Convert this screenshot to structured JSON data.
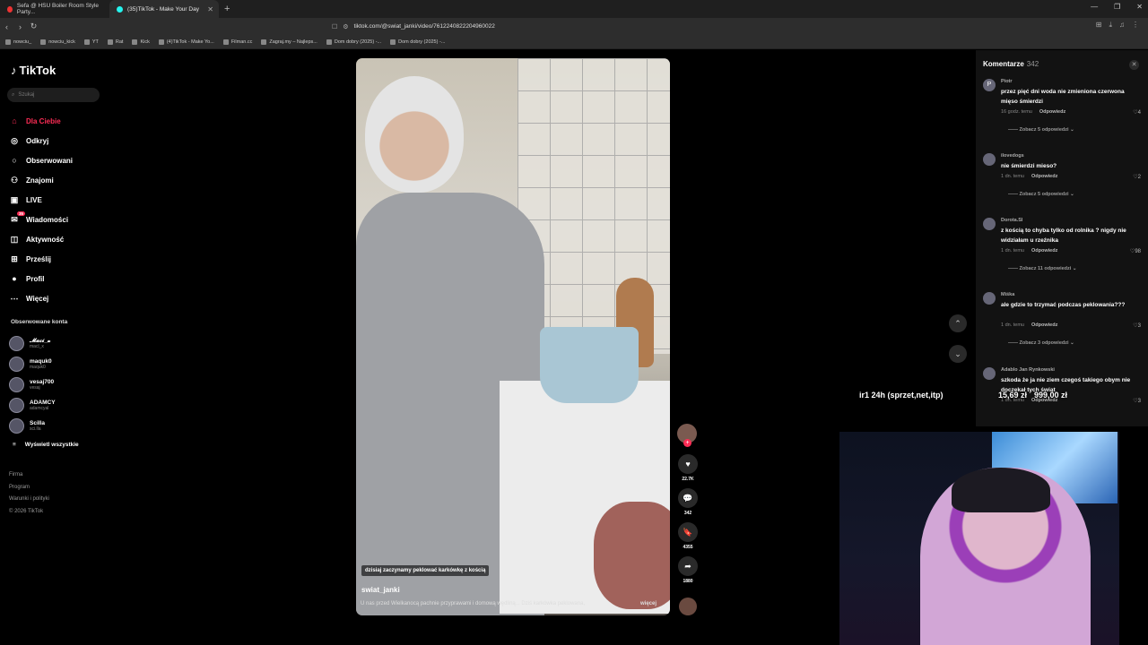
{
  "browser": {
    "tabs": [
      {
        "title": "Sefa @ HSU Boiler Room Style Party...",
        "active": false
      },
      {
        "title": "(35)TikTok - Make Your Day",
        "active": true
      }
    ],
    "url": "tiktok.com/@swiat_janki/video/7612240822204960022",
    "bookmarks": [
      "nowciu_",
      "nowciu_kick",
      "YT",
      "Rat",
      "Kick",
      "(4)TikTok - Make Yo...",
      "Filman.cc",
      "Zagraj.my – Najleps...",
      "Dom dobry (2025) -...",
      "Dom dobry (2025) -..."
    ]
  },
  "sidebar": {
    "logo": "TikTok",
    "search_placeholder": "Szukaj",
    "nav": [
      {
        "label": "Dla Ciebie",
        "icon": "home-icon",
        "active": true
      },
      {
        "label": "Odkryj",
        "icon": "compass-icon"
      },
      {
        "label": "Obserwowani",
        "icon": "following-icon"
      },
      {
        "label": "Znajomi",
        "icon": "friends-icon"
      },
      {
        "label": "LIVE",
        "icon": "live-icon"
      },
      {
        "label": "Wiadomości",
        "icon": "messages-icon",
        "badge": "35"
      },
      {
        "label": "Aktywność",
        "icon": "activity-icon"
      },
      {
        "label": "Prześlij",
        "icon": "upload-icon"
      },
      {
        "label": "Profil",
        "icon": "profile-icon"
      },
      {
        "label": "Więcej",
        "icon": "more-icon"
      }
    ],
    "followed_title": "Obserwowane konta",
    "followed": [
      {
        "name": "𝓜𝓪𝓬𝓲_𝔁",
        "handle": "macl_x"
      },
      {
        "name": "maquk0",
        "handle": "maquk0"
      },
      {
        "name": "vesaj700",
        "handle": "vesaj"
      },
      {
        "name": "ADAMCY",
        "handle": "adamcyal"
      },
      {
        "name": "Scilla",
        "handle": "sci.lla"
      }
    ],
    "show_all": "Wyświetl wszystkie",
    "footer": [
      "Firma",
      "Program",
      "Warunki i polityki",
      "© 2026 TikTok"
    ]
  },
  "video": {
    "caption_overlay": "dzisiaj zaczynamy peklować karkówkę z kością",
    "author": "swiat_janki",
    "description": "U nas przed Wielkanocą pachnie przyprawami i domową wędliną... Dziś karkówka peklowana,",
    "more": "więcej",
    "likes": "22.7K",
    "comments": "342",
    "saves": "4355",
    "shares": "1880"
  },
  "comments_panel": {
    "title": "Komentarze",
    "count": "342",
    "items": [
      {
        "user": "Piotr",
        "avatar": "P",
        "text": "przez pięć dni woda nie zmieniona czerwona mięso śmierdzi",
        "time": "16 godz. temu",
        "reply": "Odpowiedz",
        "likes": "4",
        "replies": "Zobacz 5 odpowiedzi"
      },
      {
        "user": "ilovedogs",
        "avatar": "",
        "text": "nie śmierdzi mieso?",
        "time": "1 dn. temu",
        "reply": "Odpowiedz",
        "likes": "2",
        "replies": "Zobacz 5 odpowiedzi"
      },
      {
        "user": "Dorota.Sl",
        "avatar": "",
        "text": "z kością to chyba tylko od rolnika ? nigdy nie widziałam u rzeźnika",
        "time": "1 dn. temu",
        "reply": "Odpowiedz",
        "likes": "98",
        "replies": "Zobacz 11 odpowiedzi"
      },
      {
        "user": "Miśka",
        "avatar": "",
        "text": "ale gdzie to trzymać podczas peklowania???",
        "time": "1 dn. temu",
        "reply": "Odpowiedz",
        "likes": "3",
        "replies": "Zobacz 3 odpowiedzi"
      },
      {
        "user": "Adablo Jan Rynkowski",
        "avatar": "",
        "text": "szkoda że ja nie ziem czegoś takiego obym nie doczekał tych świąt",
        "time": "1 dn. temu",
        "reply": "Odpowiedz",
        "likes": "3",
        "replies": ""
      }
    ]
  },
  "stream_overlay": {
    "goal_label": "ir1 24h (sprzet,net,itp)",
    "current": "15,69 zł",
    "target": "999,00 zł"
  }
}
